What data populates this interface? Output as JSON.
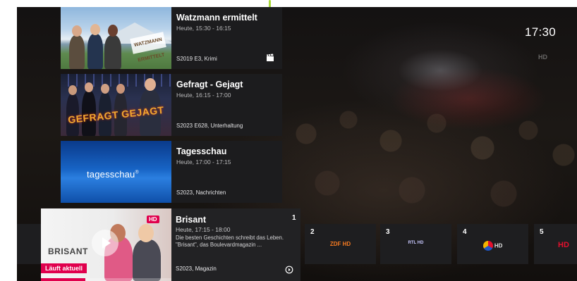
{
  "status": {
    "clock": "17:30",
    "channel_tag": "HD"
  },
  "programs": [
    {
      "title": "Watzmann ermittelt",
      "time": "Heute, 15:30 - 16:15",
      "meta": "S2019 E3, Krimi",
      "thumb_text": "WATZMANN ERMITTELT",
      "icon": "clapperboard-icon"
    },
    {
      "title": "Gefragt - Gejagt",
      "time": "Heute, 16:15 - 17:00",
      "meta": "S2023 E628, Unterhaltung",
      "thumb_text": "GEFRAGT GEJAGT"
    },
    {
      "title": "Tagesschau",
      "time": "Heute, 17:00 - 17:15",
      "meta": "S2023, Nachrichten",
      "thumb_text": "tagesschau"
    }
  ],
  "current": {
    "title": "Brisant",
    "time": "Heute, 17:15 - 18:00",
    "description": "Die besten Geschichten schreibt das Leben. \"Brisant\", das Boulevardmagazin ...",
    "meta": "S2023, Magazin",
    "channel_number": "1",
    "live_label": "Läuft aktuell",
    "thumb_text": "BRISANT",
    "channel_logo": "HD",
    "progress": 0.34,
    "icon": "replay-icon"
  },
  "channels": [
    {
      "number": "2",
      "logo": "ZDF HD",
      "color": "#f47a20"
    },
    {
      "number": "3",
      "logo": "RTL HD",
      "color": "#e0e0ff"
    },
    {
      "number": "4",
      "logo": "HD",
      "color": "#e0e0e0"
    },
    {
      "number": "5",
      "logo": "HD",
      "color": "#e3102d"
    }
  ],
  "colors": {
    "accent": "#a9d93a",
    "live": "#e0004d"
  }
}
